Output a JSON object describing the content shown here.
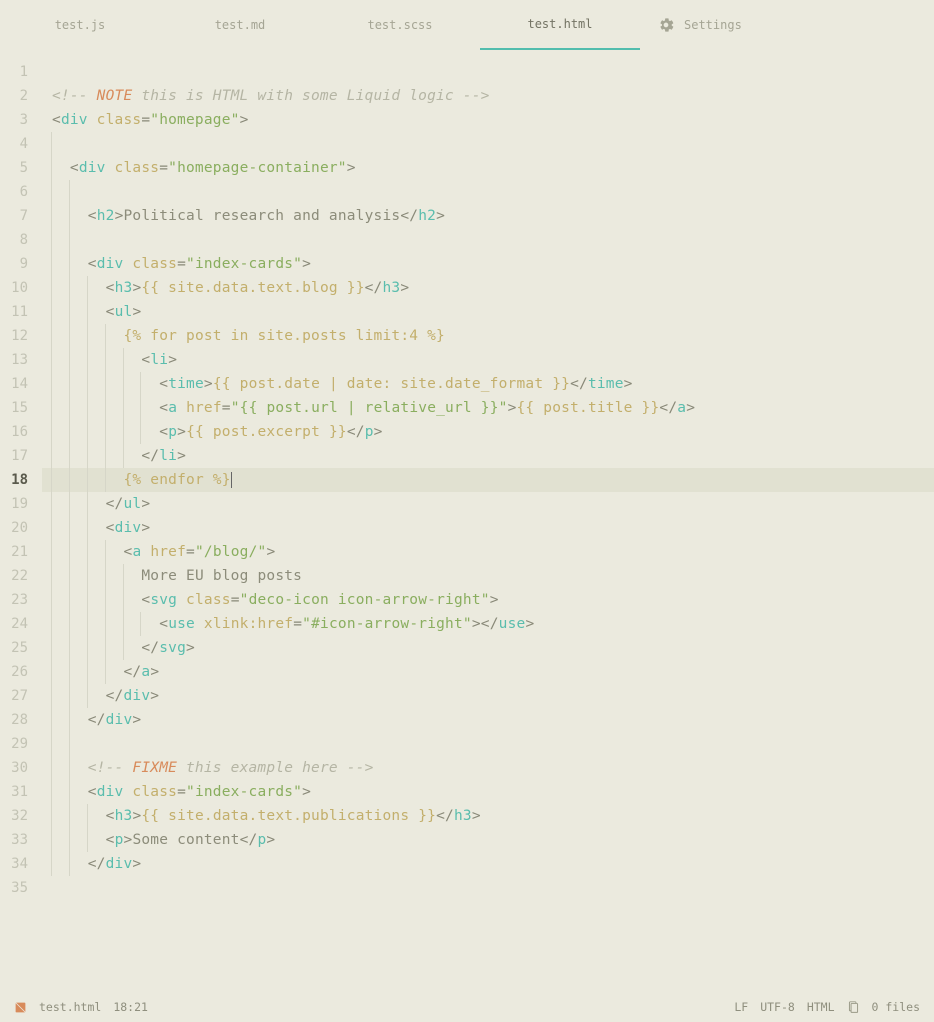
{
  "tabs": [
    {
      "label": "test.js",
      "active": false
    },
    {
      "label": "test.md",
      "active": false
    },
    {
      "label": "test.scss",
      "active": false
    },
    {
      "label": "test.html",
      "active": true
    },
    {
      "label": "Settings",
      "active": false,
      "icon": "settings-icon"
    }
  ],
  "current_line": 18,
  "lines": [
    {
      "n": 1,
      "indent": 0,
      "tokens": []
    },
    {
      "n": 2,
      "indent": 0,
      "tokens": [
        [
          "cm",
          "<!-- "
        ],
        [
          "kw",
          "NOTE"
        ],
        [
          "cm",
          " this is HTML with some Liquid logic -->"
        ]
      ]
    },
    {
      "n": 3,
      "indent": 0,
      "tokens": [
        [
          "pn",
          "<"
        ],
        [
          "tg",
          "div"
        ],
        [
          "pn",
          " "
        ],
        [
          "at",
          "class"
        ],
        [
          "pn",
          "="
        ],
        [
          "st",
          "\"homepage\""
        ],
        [
          "pn",
          ">"
        ]
      ]
    },
    {
      "n": 4,
      "indent": 1,
      "tokens": []
    },
    {
      "n": 5,
      "indent": 1,
      "tokens": [
        [
          "pn",
          "<"
        ],
        [
          "tg",
          "div"
        ],
        [
          "pn",
          " "
        ],
        [
          "at",
          "class"
        ],
        [
          "pn",
          "="
        ],
        [
          "st",
          "\"homepage-container\""
        ],
        [
          "pn",
          ">"
        ]
      ]
    },
    {
      "n": 6,
      "indent": 2,
      "tokens": []
    },
    {
      "n": 7,
      "indent": 2,
      "tokens": [
        [
          "pn",
          "<"
        ],
        [
          "tg",
          "h2"
        ],
        [
          "pn",
          ">"
        ],
        [
          "tx",
          "Political research and analysis"
        ],
        [
          "pn",
          "</"
        ],
        [
          "tg",
          "h2"
        ],
        [
          "pn",
          ">"
        ]
      ]
    },
    {
      "n": 8,
      "indent": 2,
      "tokens": []
    },
    {
      "n": 9,
      "indent": 2,
      "tokens": [
        [
          "pn",
          "<"
        ],
        [
          "tg",
          "div"
        ],
        [
          "pn",
          " "
        ],
        [
          "at",
          "class"
        ],
        [
          "pn",
          "="
        ],
        [
          "st",
          "\"index-cards\""
        ],
        [
          "pn",
          ">"
        ]
      ]
    },
    {
      "n": 10,
      "indent": 3,
      "tokens": [
        [
          "pn",
          "<"
        ],
        [
          "tg",
          "h3"
        ],
        [
          "pn",
          ">"
        ],
        [
          "en",
          "{{ site.data.text.blog }}"
        ],
        [
          "pn",
          "</"
        ],
        [
          "tg",
          "h3"
        ],
        [
          "pn",
          ">"
        ]
      ]
    },
    {
      "n": 11,
      "indent": 3,
      "tokens": [
        [
          "pn",
          "<"
        ],
        [
          "tg",
          "ul"
        ],
        [
          "pn",
          ">"
        ]
      ]
    },
    {
      "n": 12,
      "indent": 4,
      "tokens": [
        [
          "en",
          "{% for post in site.posts limit:4 %}"
        ]
      ]
    },
    {
      "n": 13,
      "indent": 5,
      "tokens": [
        [
          "pn",
          "<"
        ],
        [
          "tg",
          "li"
        ],
        [
          "pn",
          ">"
        ]
      ]
    },
    {
      "n": 14,
      "indent": 6,
      "tokens": [
        [
          "pn",
          "<"
        ],
        [
          "tg",
          "time"
        ],
        [
          "pn",
          ">"
        ],
        [
          "en",
          "{{ post.date | date: site.date_format }}"
        ],
        [
          "pn",
          "</"
        ],
        [
          "tg",
          "time"
        ],
        [
          "pn",
          ">"
        ]
      ]
    },
    {
      "n": 15,
      "indent": 6,
      "tokens": [
        [
          "pn",
          "<"
        ],
        [
          "tg",
          "a"
        ],
        [
          "pn",
          " "
        ],
        [
          "at",
          "href"
        ],
        [
          "pn",
          "="
        ],
        [
          "st",
          "\"{{ post.url | relative_url }}\""
        ],
        [
          "pn",
          ">"
        ],
        [
          "en",
          "{{ post.title }}"
        ],
        [
          "pn",
          "</"
        ],
        [
          "tg",
          "a"
        ],
        [
          "pn",
          ">"
        ]
      ]
    },
    {
      "n": 16,
      "indent": 6,
      "tokens": [
        [
          "pn",
          "<"
        ],
        [
          "tg",
          "p"
        ],
        [
          "pn",
          ">"
        ],
        [
          "en",
          "{{ post.excerpt }}"
        ],
        [
          "pn",
          "</"
        ],
        [
          "tg",
          "p"
        ],
        [
          "pn",
          ">"
        ]
      ]
    },
    {
      "n": 17,
      "indent": 5,
      "tokens": [
        [
          "pn",
          "</"
        ],
        [
          "tg",
          "li"
        ],
        [
          "pn",
          ">"
        ]
      ]
    },
    {
      "n": 18,
      "indent": 4,
      "tokens": [
        [
          "en",
          "{% endfor %}"
        ]
      ],
      "current": true
    },
    {
      "n": 19,
      "indent": 3,
      "tokens": [
        [
          "pn",
          "</"
        ],
        [
          "tg",
          "ul"
        ],
        [
          "pn",
          ">"
        ]
      ]
    },
    {
      "n": 20,
      "indent": 3,
      "tokens": [
        [
          "pn",
          "<"
        ],
        [
          "tg",
          "div"
        ],
        [
          "pn",
          ">"
        ]
      ]
    },
    {
      "n": 21,
      "indent": 4,
      "tokens": [
        [
          "pn",
          "<"
        ],
        [
          "tg",
          "a"
        ],
        [
          "pn",
          " "
        ],
        [
          "at",
          "href"
        ],
        [
          "pn",
          "="
        ],
        [
          "st",
          "\"/blog/\""
        ],
        [
          "pn",
          ">"
        ]
      ]
    },
    {
      "n": 22,
      "indent": 5,
      "tokens": [
        [
          "tx",
          "More EU blog posts"
        ]
      ]
    },
    {
      "n": 23,
      "indent": 5,
      "tokens": [
        [
          "pn",
          "<"
        ],
        [
          "tg",
          "svg"
        ],
        [
          "pn",
          " "
        ],
        [
          "at",
          "class"
        ],
        [
          "pn",
          "="
        ],
        [
          "st",
          "\"deco-icon icon-arrow-right\""
        ],
        [
          "pn",
          ">"
        ]
      ]
    },
    {
      "n": 24,
      "indent": 6,
      "tokens": [
        [
          "pn",
          "<"
        ],
        [
          "tg",
          "use"
        ],
        [
          "pn",
          " "
        ],
        [
          "at",
          "xlink:href"
        ],
        [
          "pn",
          "="
        ],
        [
          "st",
          "\"#icon-arrow-right\""
        ],
        [
          "pn",
          "></"
        ],
        [
          "tg",
          "use"
        ],
        [
          "pn",
          ">"
        ]
      ]
    },
    {
      "n": 25,
      "indent": 5,
      "tokens": [
        [
          "pn",
          "</"
        ],
        [
          "tg",
          "svg"
        ],
        [
          "pn",
          ">"
        ]
      ]
    },
    {
      "n": 26,
      "indent": 4,
      "tokens": [
        [
          "pn",
          "</"
        ],
        [
          "tg",
          "a"
        ],
        [
          "pn",
          ">"
        ]
      ]
    },
    {
      "n": 27,
      "indent": 3,
      "tokens": [
        [
          "pn",
          "</"
        ],
        [
          "tg",
          "div"
        ],
        [
          "pn",
          ">"
        ]
      ]
    },
    {
      "n": 28,
      "indent": 2,
      "tokens": [
        [
          "pn",
          "</"
        ],
        [
          "tg",
          "div"
        ],
        [
          "pn",
          ">"
        ]
      ]
    },
    {
      "n": 29,
      "indent": 2,
      "tokens": []
    },
    {
      "n": 30,
      "indent": 2,
      "tokens": [
        [
          "cm",
          "<!-- "
        ],
        [
          "kw",
          "FIXME"
        ],
        [
          "cm",
          " this example here -->"
        ]
      ]
    },
    {
      "n": 31,
      "indent": 2,
      "tokens": [
        [
          "pn",
          "<"
        ],
        [
          "tg",
          "div"
        ],
        [
          "pn",
          " "
        ],
        [
          "at",
          "class"
        ],
        [
          "pn",
          "="
        ],
        [
          "st",
          "\"index-cards\""
        ],
        [
          "pn",
          ">"
        ]
      ]
    },
    {
      "n": 32,
      "indent": 3,
      "tokens": [
        [
          "pn",
          "<"
        ],
        [
          "tg",
          "h3"
        ],
        [
          "pn",
          ">"
        ],
        [
          "en",
          "{{ site.data.text.publications }}"
        ],
        [
          "pn",
          "</"
        ],
        [
          "tg",
          "h3"
        ],
        [
          "pn",
          ">"
        ]
      ]
    },
    {
      "n": 33,
      "indent": 3,
      "tokens": [
        [
          "pn",
          "<"
        ],
        [
          "tg",
          "p"
        ],
        [
          "pn",
          ">"
        ],
        [
          "tx",
          "Some content"
        ],
        [
          "pn",
          "</"
        ],
        [
          "tg",
          "p"
        ],
        [
          "pn",
          ">"
        ]
      ]
    },
    {
      "n": 34,
      "indent": 2,
      "tokens": [
        [
          "pn",
          "</"
        ],
        [
          "tg",
          "div"
        ],
        [
          "pn",
          ">"
        ]
      ]
    },
    {
      "n": 35,
      "indent": 0,
      "tokens": []
    }
  ],
  "statusbar": {
    "filename": "test.html",
    "cursor": "18:21",
    "eol": "LF",
    "encoding": "UTF-8",
    "language": "HTML",
    "files": "0 files"
  }
}
